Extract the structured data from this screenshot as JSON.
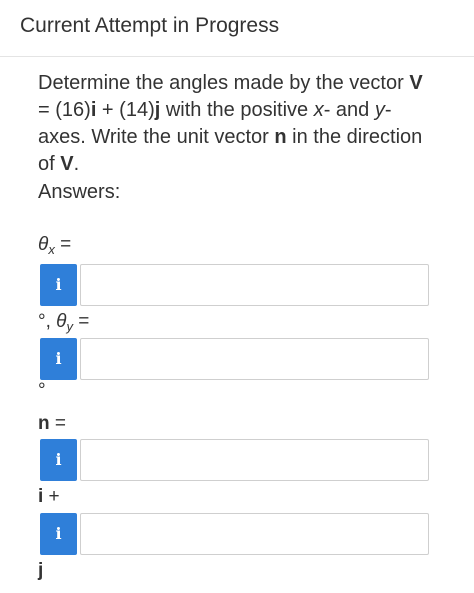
{
  "header": {
    "title": "Current Attempt in Progress"
  },
  "question": {
    "part1": "Determine the angles made by the vector ",
    "vector_symbol": "V",
    "part2": " = (16)",
    "i_symbol": "i",
    "part3": " + (14)",
    "j_symbol": "j",
    "part4": " with the positive ",
    "x_var": "x",
    "part5": "- and ",
    "y_var": "y",
    "part6": "-axes. Write the unit vector ",
    "n_symbol": "n",
    "part7": " in the direction of ",
    "vector_symbol2": "V",
    "part8": "."
  },
  "answers_label": "Answers:",
  "fields": {
    "theta_x": {
      "theta": "θ",
      "sub": "x",
      "equals": " ="
    },
    "theta_y": {
      "prefix": "°, ",
      "theta": "θ",
      "sub": "y",
      "equals": " ="
    },
    "degree_suffix": "°",
    "n_label": {
      "symbol": "n",
      "equals": " ="
    },
    "i_plus": {
      "symbol": "i",
      "plus": " +"
    },
    "j_suffix": "j",
    "info_icon_glyph": "i",
    "theta_x_value": "",
    "theta_y_value": "",
    "n_i_value": "",
    "n_j_value": ""
  },
  "colors": {
    "info_button": "#2f7fd9",
    "input_border": "#cfcfcf",
    "text": "#333333"
  },
  "icons": {
    "info": "info-icon"
  }
}
